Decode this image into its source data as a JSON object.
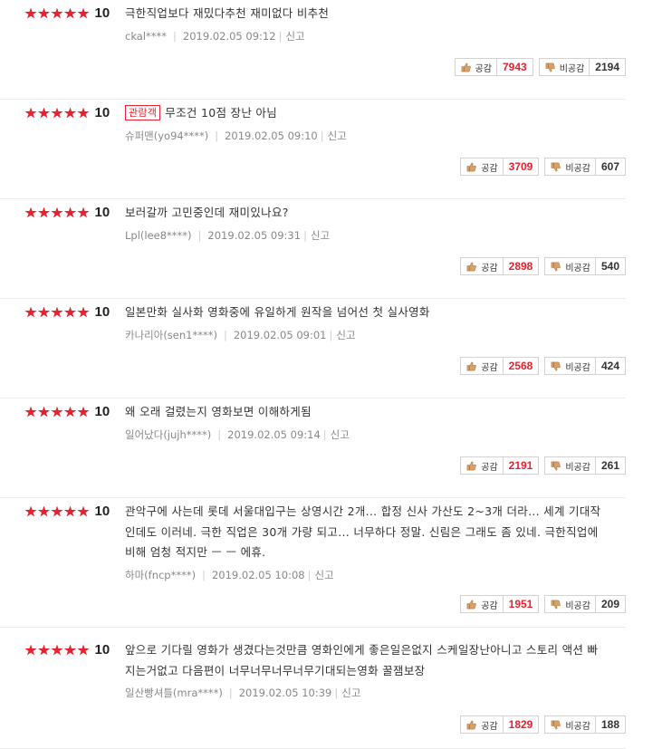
{
  "labels": {
    "like": "공감",
    "dislike": "비공감",
    "report": "신고"
  },
  "colors": {
    "accent": "#e8212f",
    "star": "#e8212f"
  },
  "reviews": [
    {
      "stars": 5,
      "score": "10",
      "badge": "",
      "text": "극한직업보다 재밌다추천 재미없다 비추천",
      "user": "ckal****",
      "date": "2019.02.05 09:12",
      "likes": "7943",
      "dislikes": "2194"
    },
    {
      "stars": 5,
      "score": "10",
      "badge": "관람객",
      "text": "무조건 10점 장난 아님",
      "user": "슈퍼맨(yo94****)",
      "date": "2019.02.05 09:10",
      "likes": "3709",
      "dislikes": "607"
    },
    {
      "stars": 5,
      "score": "10",
      "badge": "",
      "text": "보러갈까 고민중인데 재미있나요?",
      "user": "Lpl(lee8****)",
      "date": "2019.02.05 09:31",
      "likes": "2898",
      "dislikes": "540"
    },
    {
      "stars": 5,
      "score": "10",
      "badge": "",
      "text": "일본만화 실사화 영화중에 유일하게 원작을 넘어선 첫 실사영화",
      "user": "카나리아(sen1****)",
      "date": "2019.02.05 09:01",
      "likes": "2568",
      "dislikes": "424"
    },
    {
      "stars": 5,
      "score": "10",
      "badge": "",
      "text": "왜 오래 걸렸는지 영화보면 이해하게됨",
      "user": "일어났다(jujh****)",
      "date": "2019.02.05 09:14",
      "likes": "2191",
      "dislikes": "261"
    },
    {
      "stars": 5,
      "score": "10",
      "badge": "",
      "text": "관악구에 사는데 롯데 서울대입구는 상영시간 2개... 합정 신사 가산도 2~3개 더라... 세계 기대작인데도 이러네. 극한 직업은 30개 가량 되고... 너무하다 정말. 신림은 그래도 좀 있네. 극한직업에 비해 엄청 적지만 ㅡ ㅡ 에휴.",
      "user": "하마(fncp****)",
      "date": "2019.02.05 10:08",
      "likes": "1951",
      "dislikes": "209"
    },
    {
      "stars": 5,
      "score": "10",
      "badge": "",
      "text": "앞으로 기다릴 영화가 생겼다는것만큼 영화인에게 좋은일은없지 스케일장난아니고 스토리 액션 빠지는거없고 다음편이 너무너무너무너무기대되는영화 꿀잼보장",
      "user": "일산빵셔틀(mra****)",
      "date": "2019.02.05 10:39",
      "likes": "1829",
      "dislikes": "188"
    }
  ]
}
